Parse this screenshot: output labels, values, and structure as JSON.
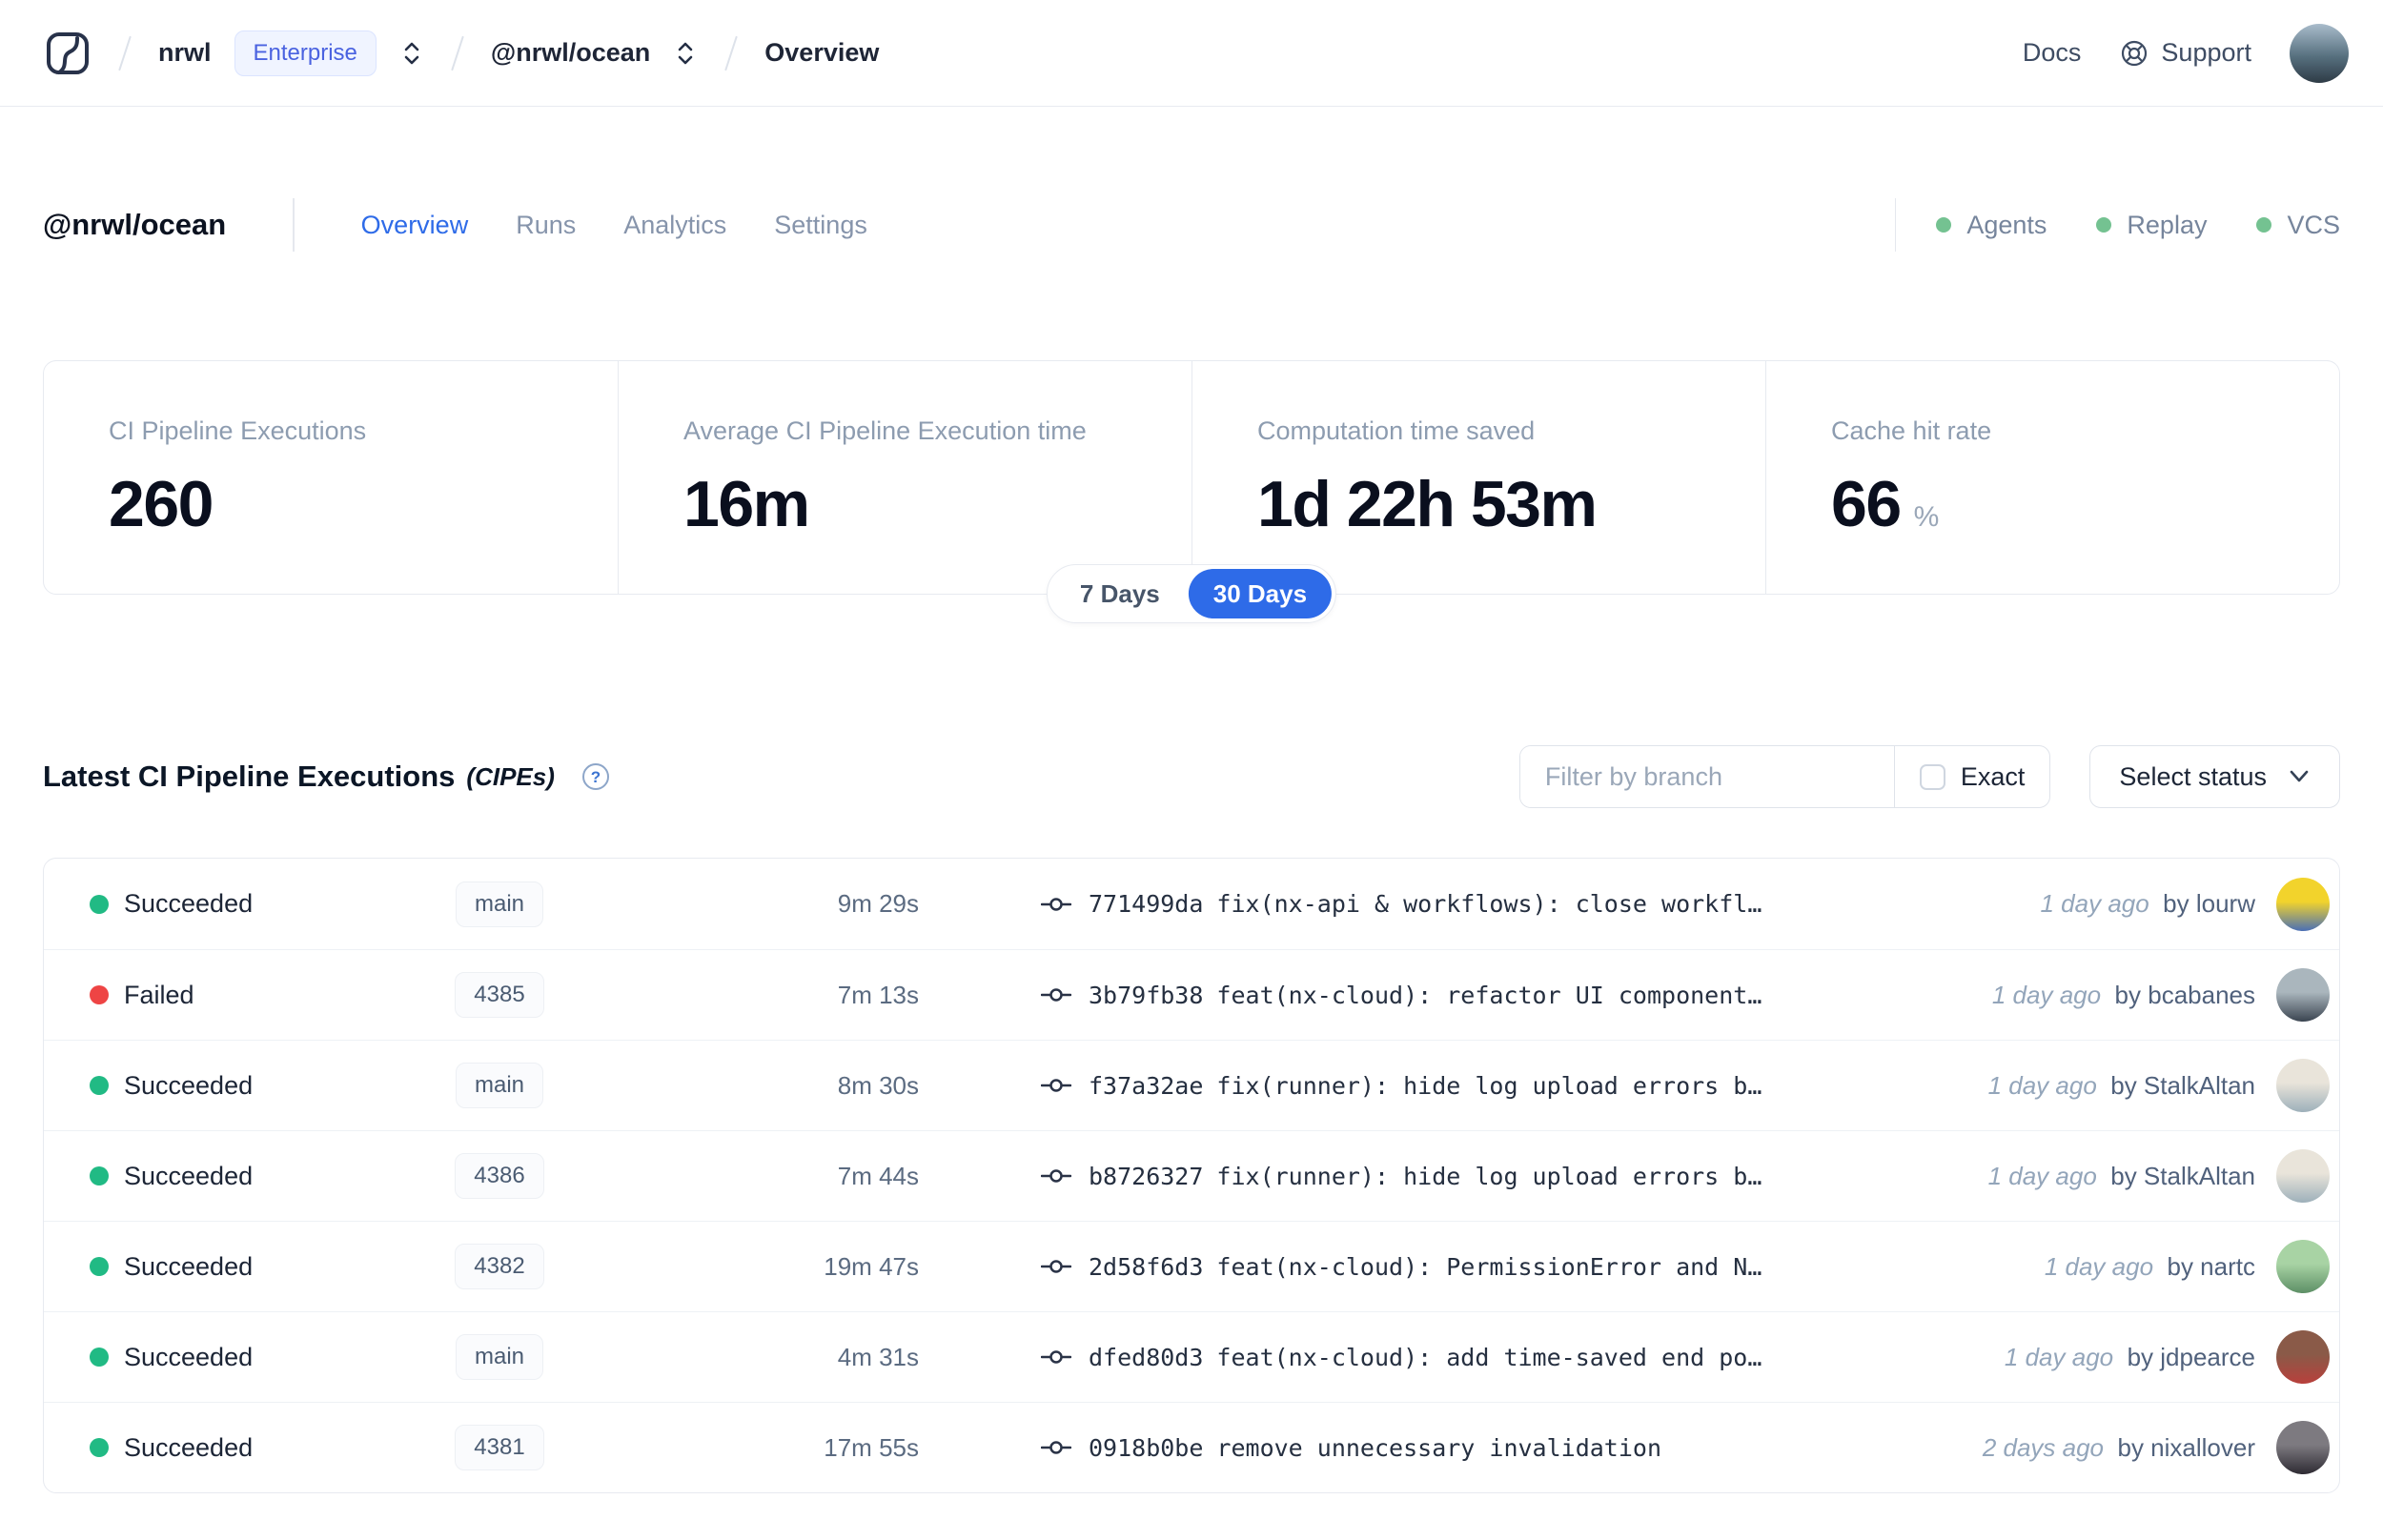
{
  "navbar": {
    "org": "nrwl",
    "org_badge": "Enterprise",
    "workspace": "@nrwl/ocean",
    "page": "Overview",
    "docs_label": "Docs",
    "support_label": "Support"
  },
  "header": {
    "title": "@nrwl/ocean",
    "tabs": [
      {
        "label": "Overview",
        "active": true
      },
      {
        "label": "Runs",
        "active": false
      },
      {
        "label": "Analytics",
        "active": false
      },
      {
        "label": "Settings",
        "active": false
      }
    ],
    "indicators": [
      {
        "label": "Agents"
      },
      {
        "label": "Replay"
      },
      {
        "label": "VCS"
      }
    ]
  },
  "stats": {
    "cards": [
      {
        "label": "CI Pipeline Executions",
        "value": "260",
        "suffix": ""
      },
      {
        "label": "Average CI Pipeline Execution time",
        "value": "16m",
        "suffix": ""
      },
      {
        "label": "Computation time saved",
        "value": "1d 22h 53m",
        "suffix": ""
      },
      {
        "label": "Cache hit rate",
        "value": "66",
        "suffix": "%"
      }
    ],
    "range_toggle": {
      "options": [
        "7 Days",
        "30 Days"
      ],
      "selected": "30 Days"
    }
  },
  "section": {
    "title": "Latest CI Pipeline Executions",
    "subtitle": "(CIPEs)",
    "filter_placeholder": "Filter by branch",
    "exact_label": "Exact",
    "exact_checked": false,
    "status_dropdown_label": "Select status"
  },
  "table": {
    "rows": [
      {
        "status": "Succeeded",
        "status_color": "#21ba84",
        "branch": "main",
        "duration": "9m 29s",
        "commit_hash": "771499da",
        "commit_message": "fix(nx-api & workflows): close workfl…",
        "time_ago": "1 day ago",
        "author": "by lourw",
        "avatar_colors": [
          "#f2d32c",
          "#4a6fb5"
        ]
      },
      {
        "status": "Failed",
        "status_color": "#ee4444",
        "branch": "4385",
        "duration": "7m 13s",
        "commit_hash": "3b79fb38",
        "commit_message": "feat(nx-cloud): refactor UI component…",
        "time_ago": "1 day ago",
        "author": "by bcabanes",
        "avatar_colors": [
          "#aab6bd",
          "#3a4450"
        ]
      },
      {
        "status": "Succeeded",
        "status_color": "#21ba84",
        "branch": "main",
        "duration": "8m 30s",
        "commit_hash": "f37a32ae",
        "commit_message": "fix(runner): hide log upload errors b…",
        "time_ago": "1 day ago",
        "author": "by StalkAltan",
        "avatar_colors": [
          "#e9e4da",
          "#9db0ba"
        ]
      },
      {
        "status": "Succeeded",
        "status_color": "#21ba84",
        "branch": "4386",
        "duration": "7m 44s",
        "commit_hash": "b8726327",
        "commit_message": "fix(runner): hide log upload errors b…",
        "time_ago": "1 day ago",
        "author": "by StalkAltan",
        "avatar_colors": [
          "#e9e4da",
          "#9db0ba"
        ]
      },
      {
        "status": "Succeeded",
        "status_color": "#21ba84",
        "branch": "4382",
        "duration": "19m 47s",
        "commit_hash": "2d58f6d3",
        "commit_message": "feat(nx-cloud): PermissionError and N…",
        "time_ago": "1 day ago",
        "author": "by nartc",
        "avatar_colors": [
          "#a8d3a4",
          "#5d8f66"
        ]
      },
      {
        "status": "Succeeded",
        "status_color": "#21ba84",
        "branch": "main",
        "duration": "4m 31s",
        "commit_hash": "dfed80d3",
        "commit_message": "feat(nx-cloud): add time-saved end po…",
        "time_ago": "1 day ago",
        "author": "by jdpearce",
        "avatar_colors": [
          "#8a5a48",
          "#b8403c"
        ]
      },
      {
        "status": "Succeeded",
        "status_color": "#21ba84",
        "branch": "4381",
        "duration": "17m 55s",
        "commit_hash": "0918b0be",
        "commit_message": "remove unnecessary invalidation",
        "time_ago": "2 days ago",
        "author": "by nixallover",
        "avatar_colors": [
          "#7d7a80",
          "#2e2b33"
        ]
      }
    ]
  },
  "colors": {
    "accent_blue": "#2e6be8",
    "success_green": "#21ba84",
    "failed_red": "#ee4444",
    "indicator_green": "#74c291"
  }
}
